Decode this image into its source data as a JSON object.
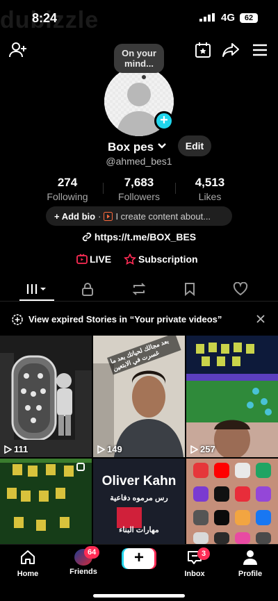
{
  "status": {
    "time": "8:24",
    "network": "4G",
    "battery": "62",
    "watermark": "dubizzle"
  },
  "bubble": {
    "text_line1": "On your",
    "text_line2": "mind..."
  },
  "profile": {
    "name": "Box pes",
    "edit_label": "Edit",
    "username": "@ahmed_bes1",
    "stats": [
      {
        "num": "274",
        "label": "Following"
      },
      {
        "num": "7,683",
        "label": "Followers"
      },
      {
        "num": "4,513",
        "label": "Likes"
      }
    ],
    "add_bio": "+ Add bio",
    "bio_sep": "·",
    "bio_text": "I create content about...",
    "link": "https://t.me/BOX_BES",
    "live_label": "LIVE",
    "subscription_label": "Subscription"
  },
  "banner": {
    "text": "View expired Stories in “Your private videos”"
  },
  "videos": [
    {
      "views": "111"
    },
    {
      "views": "149",
      "overlay_line1": "بعد مجالك لحياتك بعد ما",
      "overlay_line2": "غسرت في الابتعين"
    },
    {
      "views": "257"
    },
    {
      "views": ""
    },
    {
      "views": "",
      "title": "Oliver Kahn",
      "sub1": "رس مرموه دفاعية",
      "sub2": "مهارات البناء"
    },
    {
      "views": ""
    }
  ],
  "nav": {
    "home": "Home",
    "friends": "Friends",
    "friends_badge": "64",
    "inbox": "Inbox",
    "inbox_badge": "3",
    "profile": "Profile"
  },
  "colors": {
    "accent_cyan": "#20d5ec",
    "accent_red": "#ff2c55",
    "background": "#000000"
  }
}
